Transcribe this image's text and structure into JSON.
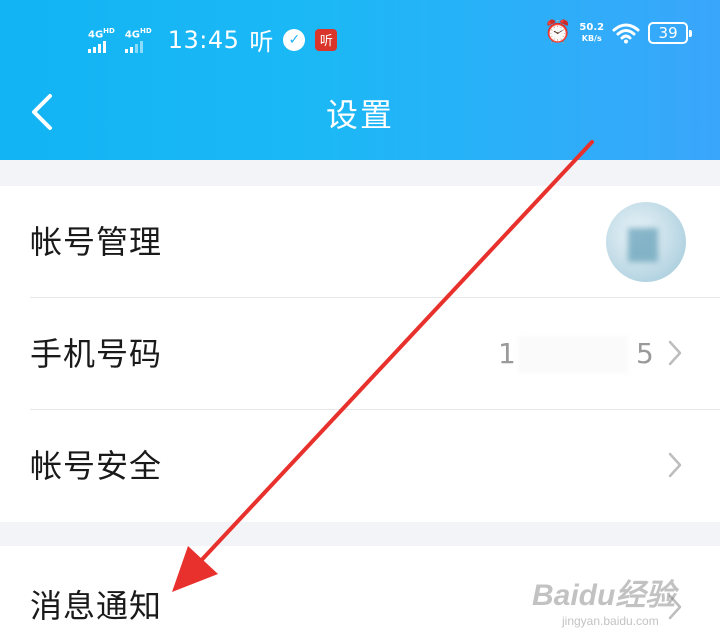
{
  "status_bar": {
    "signal1": "4G",
    "signal1_sup": "HD",
    "signal2": "4G",
    "signal2_sup": "HD",
    "time": "13:45",
    "app_glyph": "听",
    "speed_value": "50.2",
    "speed_unit": "KB/s",
    "battery": "39",
    "icons": [
      "signal-icon",
      "alarm-icon",
      "wifi-icon",
      "battery-icon"
    ]
  },
  "header": {
    "title": "设置",
    "back_icon": "chevron-left-icon"
  },
  "settings": {
    "account_manage": "帐号管理",
    "phone_number": "手机号码",
    "phone_first": "1",
    "phone_last": "5",
    "account_security": "帐号安全",
    "message_notify": "消息通知"
  },
  "watermark": {
    "brand": "Baidu经验",
    "site": "jingyan.baidu.com"
  },
  "colors": {
    "header_start": "#12b4f4",
    "header_end": "#3aa6fb",
    "arrow": "#e8312c"
  }
}
